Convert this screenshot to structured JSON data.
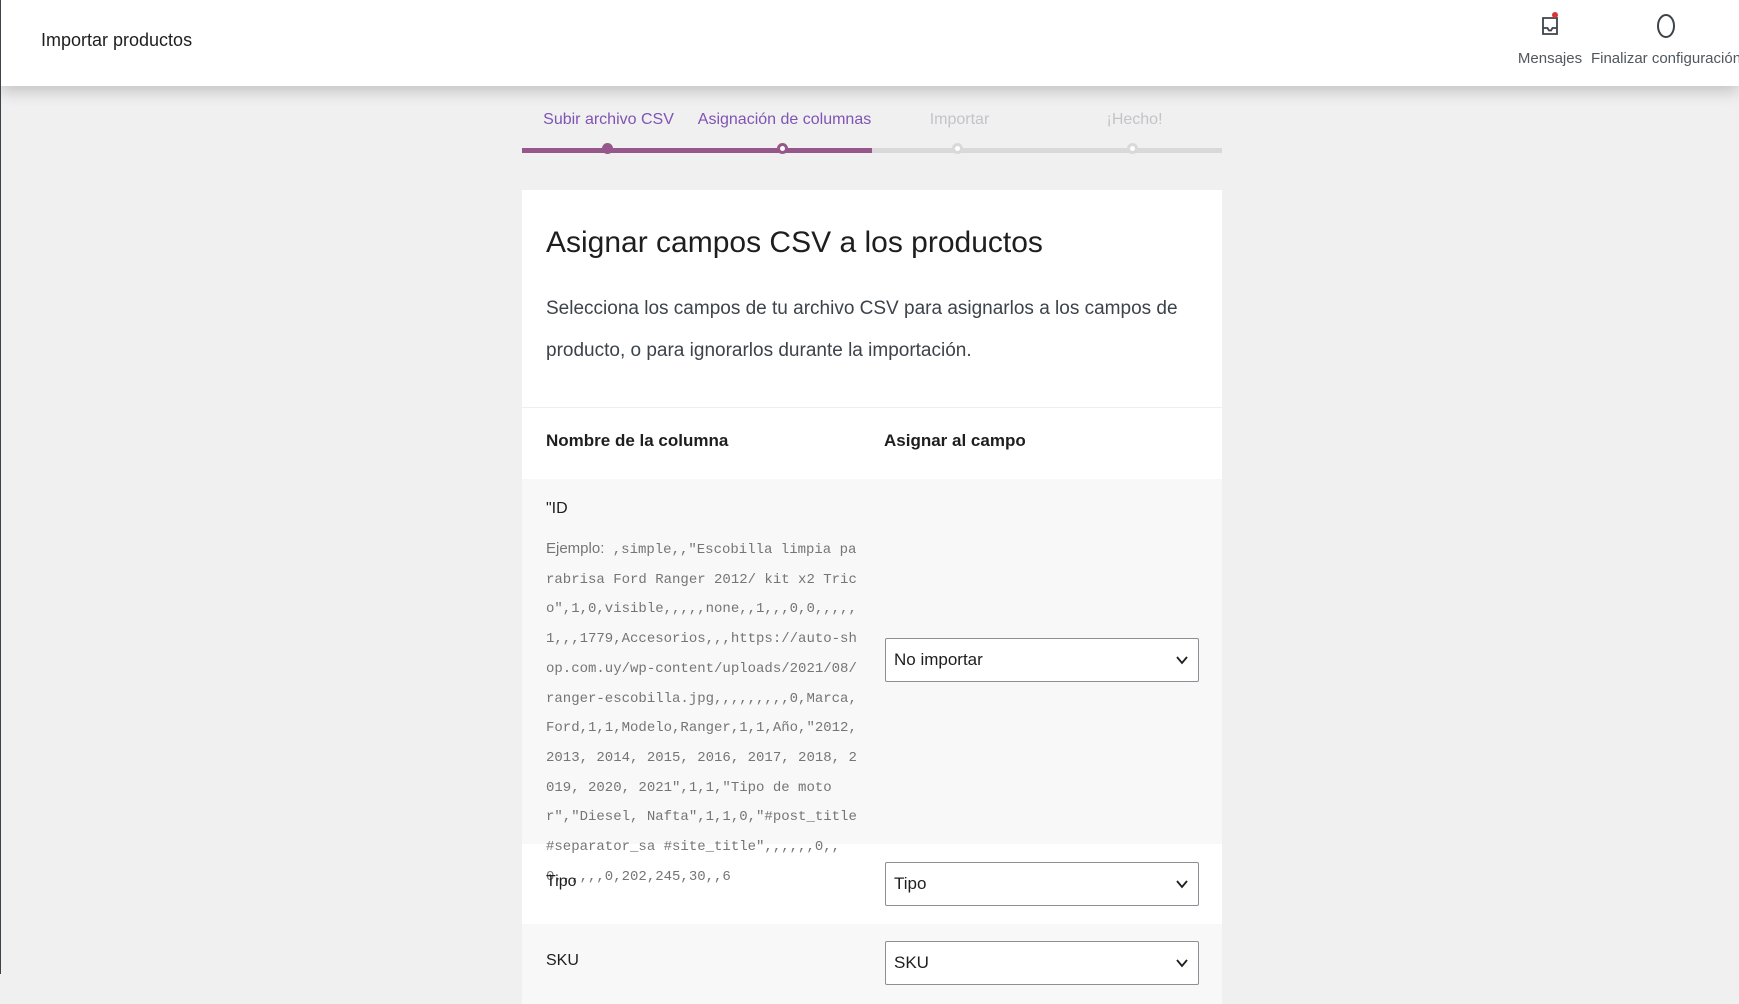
{
  "header": {
    "title": "Importar productos",
    "actions": [
      {
        "label": "Mensajes",
        "icon": "inbox-icon",
        "has_notification": true
      },
      {
        "label": "Finalizar configuración",
        "icon": "progress-circle-icon"
      }
    ]
  },
  "stepper": {
    "steps": [
      {
        "label": "Subir archivo CSV",
        "state": "done"
      },
      {
        "label": "Asignación de columnas",
        "state": "current"
      },
      {
        "label": "Importar",
        "state": "todo"
      },
      {
        "label": "¡Hecho!",
        "state": "todo"
      }
    ],
    "progress_fraction": 0.5
  },
  "card": {
    "title": "Asignar campos CSV a los productos",
    "description": "Selecciona los campos de tu archivo CSV para asignarlos a los campos de producto, o para ignorarlos durante la importación.",
    "column_header_name": "Nombre de la columna",
    "column_header_map": "Asignar al campo",
    "rows": [
      {
        "name": "\"ID",
        "example_label": "Ejemplo:",
        "example_value": ",simple,,\"Escobilla limpia parabrisa Ford Ranger 2012/ kit x2 Trico\",1,0,visible,,,,,none,,1,,,0,0,,,,,1,,,1779,Accesorios,,,https://auto-shop.com.uy/wp-content/uploads/2021/08/ranger-escobilla.jpg,,,,,,,,,0,Marca,Ford,1,1,Modelo,Ranger,1,1,Año,\"2012, 2013, 2014, 2015, 2016, 2017, 2018, 2019, 2020, 2021\",1,1,\"Tipo de motor\",\"Diesel, Nafta\",1,1,0,\"#post_title #separator_sa #site_title\",,,,,,0,,0,,,,,,0,202,245,30,,6",
        "selected": "No importar"
      },
      {
        "name": "Tipo",
        "selected": "Tipo"
      },
      {
        "name": "SKU",
        "selected": "SKU"
      }
    ]
  },
  "colors": {
    "accent": "#96588a",
    "accent_text": "#7f54b3",
    "inactive": "#c3c4c7",
    "notification": "#d63638"
  }
}
